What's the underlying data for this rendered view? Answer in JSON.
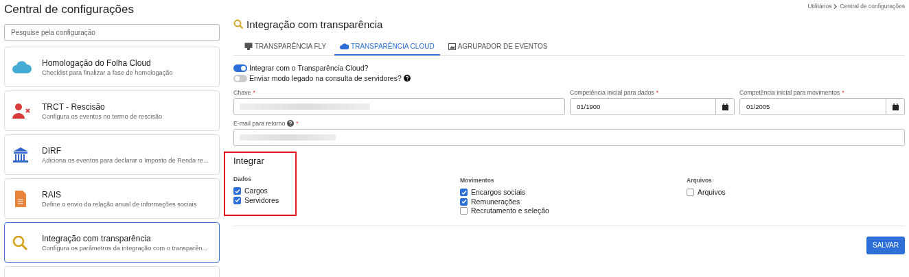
{
  "title": "Central de configurações",
  "breadcrumb": [
    "Utilitários",
    "Central de configurações"
  ],
  "search": {
    "placeholder": "Pesquise pela configuração"
  },
  "cards": [
    {
      "kind": "cloud",
      "title": "Homologação do Folha Cloud",
      "description": "Checklist para finalizar a fase de homologação",
      "selected": false
    },
    {
      "kind": "user-x",
      "title": "TRCT - Rescisão",
      "description": "Configura os eventos no termo de rescisão",
      "selected": false
    },
    {
      "kind": "bank",
      "title": "DIRF",
      "description": "Adiciona os eventos para declarar o Imposto de Renda re...",
      "selected": false
    },
    {
      "kind": "file",
      "title": "RAIS",
      "description": "Define o envio da relação anual de informações sociais",
      "selected": false
    },
    {
      "kind": "search",
      "title": "Integração com transparência",
      "description": "Configura os parâmetros da integração com o transparên...",
      "selected": true
    },
    {
      "kind": "cut",
      "selected": false
    }
  ],
  "panel": {
    "title": "Integração com transparência",
    "tabs": [
      {
        "kind": "monitor",
        "label": "TRANSPARÊNCIA FLY",
        "selected": false
      },
      {
        "kind": "cloud",
        "label": "TRANSPARÊNCIA CLOUD",
        "selected": true
      },
      {
        "kind": "image",
        "label": "AGRUPADOR DE EVENTOS",
        "selected": false
      }
    ],
    "toggles": [
      {
        "label": "Integrar com o Transparência Cloud?",
        "on": true,
        "help": false
      },
      {
        "label": "Enviar modo legado na consulta de servidores?",
        "on": false,
        "help": true
      }
    ],
    "fields": [
      {
        "kind": "redacted",
        "label": "Chave",
        "required_mark": "*",
        "help": false
      },
      {
        "kind": "date",
        "label": "Competência inicial para dados",
        "required_mark": "*",
        "help": false,
        "value": "01/1900"
      },
      {
        "kind": "date",
        "label": "Competência inicial para movimentos",
        "required_mark": "*",
        "help": false,
        "value": "01/2005"
      },
      {
        "kind": "redacted-full",
        "label": "E-mail para retorno",
        "required_mark": "*",
        "help": true
      }
    ],
    "integrar": {
      "title": "Integrar",
      "highlighted": true,
      "groups": [
        {
          "label": "Dados",
          "items": [
            {
              "label": "Cargos",
              "checked": true
            },
            {
              "label": "Servidores",
              "checked": true
            }
          ]
        },
        {
          "label": "Movimentos",
          "items": [
            {
              "label": "Encargos sociais",
              "checked": true
            },
            {
              "label": "Remunerações",
              "checked": true
            },
            {
              "label": "Recrutamento e seleção",
              "checked": false
            }
          ]
        },
        {
          "label": "Arquivos",
          "items": [
            {
              "label": "Arquivos",
              "checked": false
            }
          ]
        }
      ]
    },
    "save_button": "SALVAR"
  }
}
